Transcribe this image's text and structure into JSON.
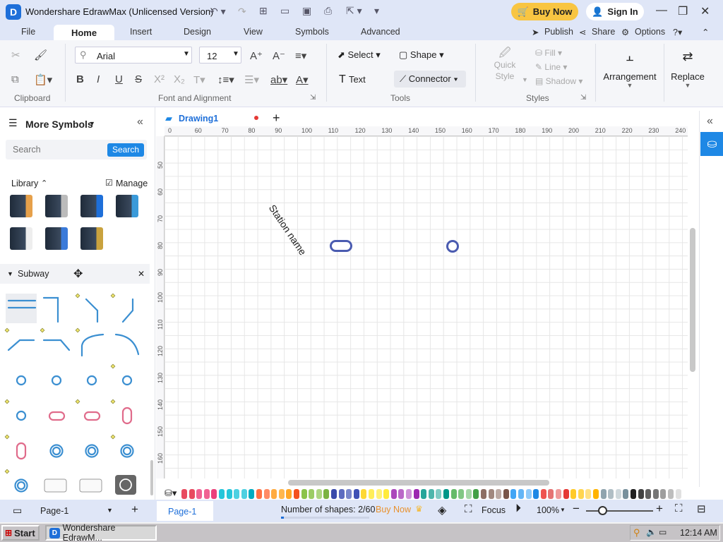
{
  "titlebar": {
    "title": "Wondershare EdrawMax (Unlicensed Version)",
    "buy_now": "Buy Now",
    "sign_in": "Sign In"
  },
  "menu": {
    "tabs": [
      "File",
      "Home",
      "Insert",
      "Design",
      "View",
      "Symbols",
      "Advanced"
    ],
    "publish": "Publish",
    "share": "Share",
    "options": "Options"
  },
  "ribbon": {
    "font_name": "Arial",
    "font_size": "12",
    "select": "Select",
    "shape": "Shape",
    "text": "Text",
    "connector": "Connector",
    "fill": "Fill",
    "line": "Line",
    "shadow": "Shadow",
    "quick_style_1": "Quick",
    "quick_style_2": "Style",
    "arrangement": "Arrangement",
    "replace": "Replace",
    "group_clipboard": "Clipboard",
    "group_font": "Font and Alignment",
    "group_tools": "Tools",
    "group_styles": "Styles"
  },
  "left_panel": {
    "title": "More Symbols",
    "search_placeholder": "Search",
    "search_button": "Search",
    "library": "Library",
    "manage": "Manage",
    "section": "Subway"
  },
  "document": {
    "tab_name": "Drawing1"
  },
  "rulers": {
    "h": [
      "0",
      "60",
      "70",
      "80",
      "90",
      "100",
      "110",
      "120",
      "130",
      "140",
      "150",
      "160",
      "170",
      "180",
      "190",
      "200",
      "210",
      "220",
      "230",
      "240"
    ],
    "v": [
      "50",
      "60",
      "70",
      "80",
      "90",
      "100",
      "110",
      "120",
      "130",
      "140",
      "150",
      "160"
    ]
  },
  "canvas": {
    "station_label": "Station name"
  },
  "status": {
    "page_selector": "Page-1",
    "page_tab": "Page-1",
    "shapes_count": "Number of shapes: 2/60",
    "buy_now": "Buy Now",
    "focus": "Focus",
    "zoom": "100%"
  },
  "taskbar": {
    "start": "Start",
    "task": "Wondershare EdrawM...",
    "clock": "12:14 AM"
  },
  "colors": {
    "accent": "#1e88e5",
    "station": "#4a5bb0",
    "buy": "#f8c542",
    "line": "#3b8fd1",
    "palette": [
      "#e84a5f",
      "#e84a5f",
      "#f06292",
      "#f06292",
      "#ec407a",
      "#26c6da",
      "#26c6da",
      "#4dd0e1",
      "#4dd0e1",
      "#00acc1",
      "#ff7043",
      "#ff8a65",
      "#ffab40",
      "#ffb74d",
      "#ffa726",
      "#f4511e",
      "#8bc34a",
      "#9ccc65",
      "#aed581",
      "#7cb342",
      "#3949ab",
      "#5c6bc0",
      "#7986cb",
      "#3f51b5",
      "#fdd835",
      "#ffee58",
      "#fff176",
      "#ffeb3b",
      "#ab47bc",
      "#ba68c8",
      "#ce93d8",
      "#9c27b0",
      "#26a69a",
      "#4db6ac",
      "#80cbc4",
      "#009688",
      "#66bb6a",
      "#81c784",
      "#a5d6a7",
      "#43a047",
      "#8d6e63",
      "#a1887f",
      "#bcaaa4",
      "#795548",
      "#42a5f5",
      "#64b5f6",
      "#90caf9",
      "#1e88e5",
      "#ef5350",
      "#e57373",
      "#ef9a9a",
      "#e53935",
      "#ffca28",
      "#ffd54f",
      "#ffe082",
      "#ffb300",
      "#90a4ae",
      "#b0bec5",
      "#cfd8dc",
      "#78909c",
      "#212121",
      "#424242",
      "#616161",
      "#757575",
      "#9e9e9e",
      "#bdbdbd",
      "#e0e0e0"
    ]
  }
}
